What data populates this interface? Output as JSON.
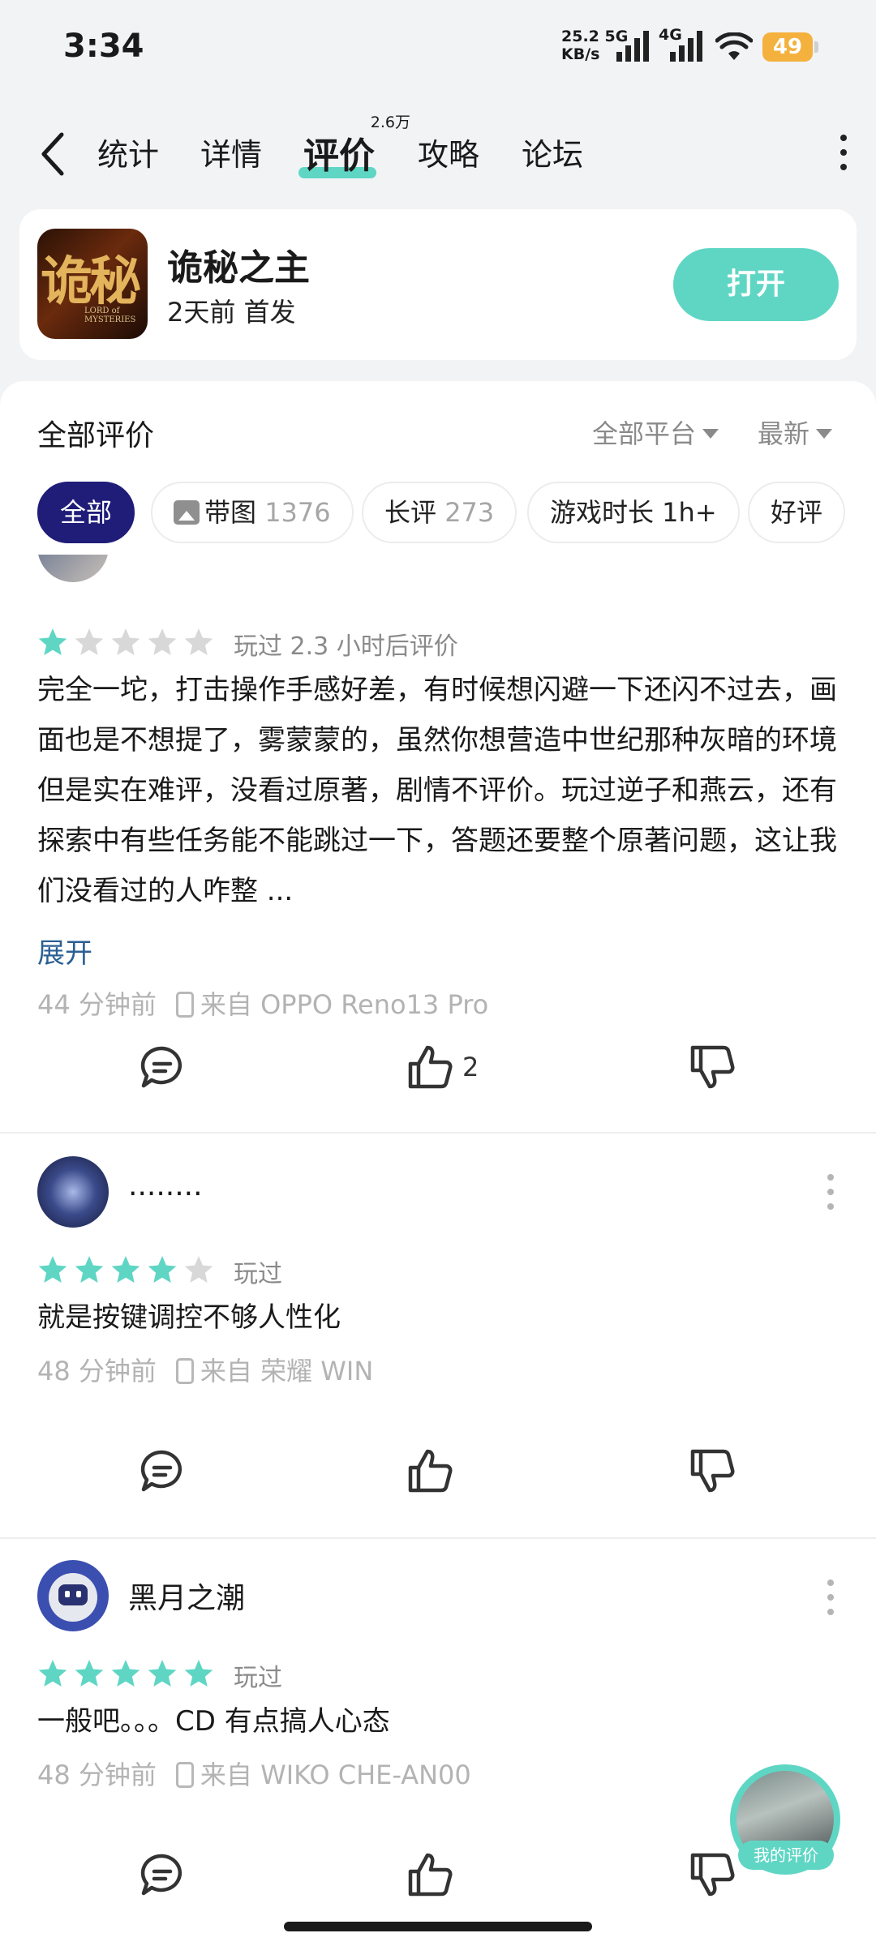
{
  "status_bar": {
    "time": "3:34",
    "speed_value": "25.2",
    "speed_unit": "KB/s",
    "net1": "5G",
    "net2": "4G",
    "battery": "49"
  },
  "nav": {
    "tabs": [
      {
        "label": "统计"
      },
      {
        "label": "详情"
      },
      {
        "label": "评价",
        "badge": "2.6万"
      },
      {
        "label": "攻略"
      },
      {
        "label": "论坛"
      }
    ],
    "active_tab": "评价"
  },
  "app": {
    "name": "诡秘之主",
    "meta": "2天前 首发",
    "open_label": "打开",
    "icon_text": "诡秘",
    "icon_subtext": "LORD of MYSTERIES"
  },
  "reviews_header": {
    "title": "全部评价",
    "platform_filter": "全部平台",
    "sort_filter": "最新"
  },
  "chips": [
    {
      "label": "全部",
      "count": ""
    },
    {
      "label": "带图",
      "count": "1376"
    },
    {
      "label": "长评",
      "count": "273"
    },
    {
      "label": "游戏时长 1h+",
      "count": ""
    },
    {
      "label": "好评",
      "count": ""
    }
  ],
  "reviews": [
    {
      "username": "",
      "rating": 1,
      "played": "玩过 2.3 小时后评价",
      "text": "完全一坨，打击操作手感好差，有时候想闪避一下还闪不过去，画面也是不想提了，雾蒙蒙的，虽然你想营造中世纪那种灰暗的环境但是实在难评，没看过原著，剧情不评价。玩过逆子和燕云，还有探索中有些任务能不能跳过一下，答题还要整个原著问题，这让我们没看过的人咋整 ...",
      "expand": "展开",
      "time": "44 分钟前",
      "device": "来自 OPPO Reno13 Pro",
      "likes": "2"
    },
    {
      "username": "........",
      "rating": 4,
      "played": "玩过",
      "text": "就是按键调控不够人性化",
      "time": "48 分钟前",
      "device": "来自 荣耀 WIN",
      "likes": ""
    },
    {
      "username": "黑月之潮",
      "rating": 5,
      "played": "玩过",
      "text": "一般吧。。。CD 有点搞人心态",
      "time": "48 分钟前",
      "device": "来自 WIKO CHE-AN00",
      "likes": ""
    }
  ],
  "fab": {
    "label": "我的评价"
  },
  "colors": {
    "accent": "#5fd6c4",
    "chip_active": "#1f1d78",
    "star_on": "#5fd6c4",
    "star_off": "#d8d8d8",
    "link": "#2a5f93"
  }
}
